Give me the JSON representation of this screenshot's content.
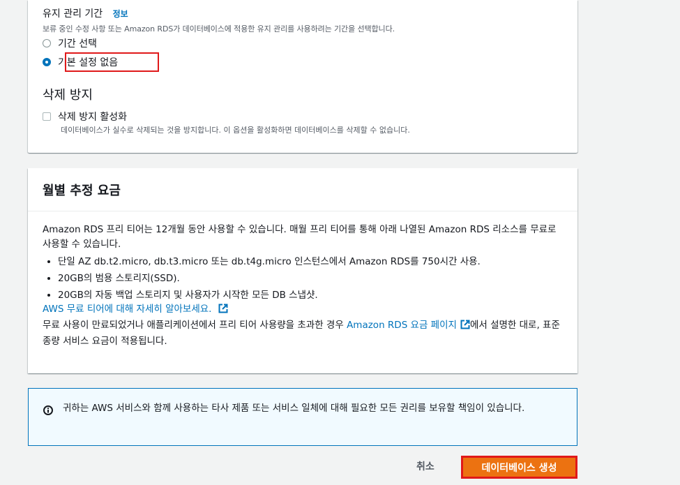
{
  "maintenance": {
    "title": "유지 관리 기간",
    "info_link": "정보",
    "description": "보류 중인 수정 사항 또는 Amazon RDS가 데이터베이스에 적용한 유지 관리를 사용하려는 기간을 선택합니다.",
    "options": [
      {
        "label": "기간 선택",
        "selected": false
      },
      {
        "label": "기본 설정 없음",
        "selected": true
      }
    ]
  },
  "deletion_protection": {
    "heading": "삭제 방지",
    "checkbox_label": "삭제 방지 활성화",
    "checked": false,
    "description": "데이터베이스가 실수로 삭제되는 것을 방지합니다. 이 옵션을 활성화하면 데이터베이스를 삭제할 수 없습니다."
  },
  "monthly_cost": {
    "title": "월별 추정 요금",
    "intro": "Amazon RDS 프리 티어는 12개월 동안 사용할 수 있습니다. 매월 프리 티어를 통해 아래 나열된 Amazon RDS 리소스를 무료로 사용할 수 있습니다.",
    "bullets": [
      "단일 AZ db.t2.micro, db.t3.micro 또는 db.t4g.micro 인스턴스에서 Amazon RDS를 750시간 사용.",
      "20GB의 범용 스토리지(SSD).",
      "20GB의 자동 백업 스토리지 및 사용자가 시작한 모든 DB 스냅샷."
    ],
    "free_tier_link": "AWS 무료 티어에 대해 자세히 알아보세요.",
    "outro_before": "무료 사용이 만료되었거나 애플리케이션에서 프리 티어 사용량을 초과한 경우 ",
    "pricing_link": "Amazon RDS 요금 페이지",
    "outro_after": "에서 설명한 대로, 표준 종량 서비스 요금이 적용됩니다."
  },
  "notice": {
    "text": "귀하는 AWS 서비스와 함께 사용하는 타사 제품 또는 서비스 일체에 대해 필요한 모든 권리를 보유할 책임이 있습니다."
  },
  "footer": {
    "cancel_label": "취소",
    "create_label": "데이터베이스 생성"
  },
  "colors": {
    "link": "#0073bb",
    "primary_button": "#ec7211",
    "highlight": "#e0191a"
  }
}
